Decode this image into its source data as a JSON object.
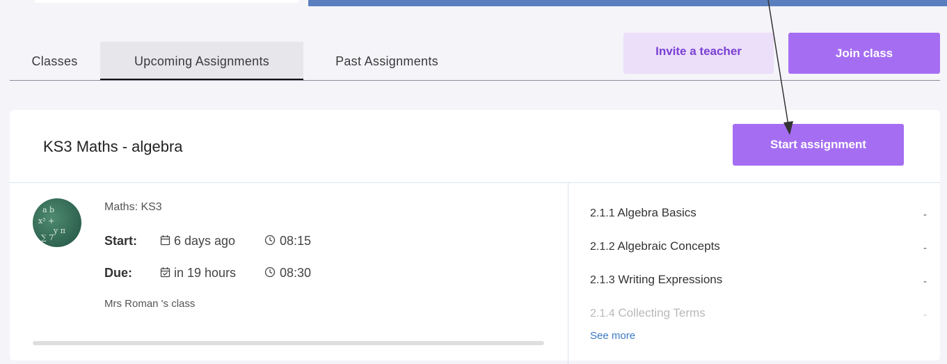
{
  "tabs": [
    {
      "label": "Classes"
    },
    {
      "label": "Upcoming Assignments",
      "active": true
    },
    {
      "label": "Past Assignments"
    }
  ],
  "header_buttons": {
    "invite": "Invite a teacher",
    "join": "Join class"
  },
  "assignment": {
    "title": "KS3 Maths - algebra",
    "start_button": "Start assignment",
    "subject": "Maths: KS3",
    "start_label": "Start:",
    "start_date": "6 days ago",
    "start_time": "08:15",
    "due_label": "Due:",
    "due_date": "in 19 hours",
    "due_time": "08:30",
    "class_name": "Mrs Roman 's class",
    "topics": [
      {
        "code": "2.1.1",
        "name": "Algebra Basics",
        "status": "-"
      },
      {
        "code": "2.1.2",
        "name": "Algebraic Concepts",
        "status": "-"
      },
      {
        "code": "2.1.3",
        "name": "Writing Expressions",
        "status": "-"
      },
      {
        "code": "2.1.4",
        "name": "Collecting Terms",
        "status": "-"
      }
    ],
    "see_more": "See more"
  },
  "colors": {
    "accent": "#a56ef2",
    "accent_light": "#ecdff9",
    "top_bar": "#5b7fbe",
    "link": "#3a79c4"
  },
  "icons": {
    "calendar": "calendar-icon",
    "calendar_check": "calendar-check-icon",
    "clock": "clock-icon"
  }
}
